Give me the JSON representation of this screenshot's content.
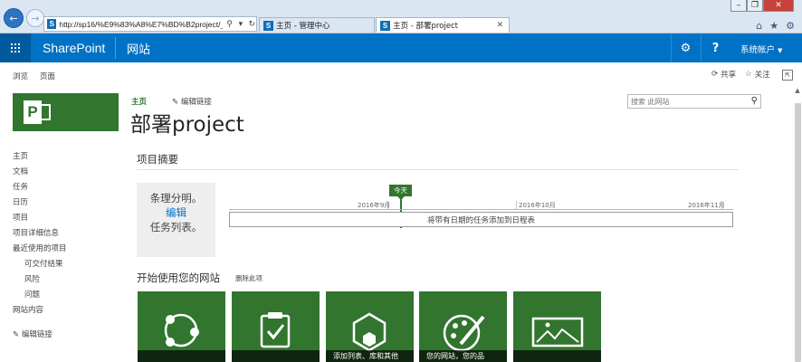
{
  "browser": {
    "address_url": "http://sp16/%E9%83%A8%E7%BD%B2project/_la",
    "tabs": [
      {
        "label": "主页 - 管理中心"
      },
      {
        "label": "主页 - 部署project"
      }
    ]
  },
  "suite_bar": {
    "brand": "SharePoint",
    "sites_label": "网站",
    "user_label": "系统帐户",
    "accent": "#0072c6"
  },
  "ribbon": {
    "tabs": [
      "浏览",
      "页面"
    ],
    "share_label": "共享",
    "follow_label": "关注"
  },
  "site": {
    "top_nav_home": "主页",
    "edit_links": "编辑链接",
    "title": "部署project",
    "search_placeholder": "搜索 此网站",
    "brand_green": "#31752f"
  },
  "quick_launch": {
    "items": [
      {
        "label": "主页",
        "sub": false
      },
      {
        "label": "文档",
        "sub": false
      },
      {
        "label": "任务",
        "sub": false
      },
      {
        "label": "日历",
        "sub": false
      },
      {
        "label": "项目",
        "sub": false
      },
      {
        "label": "项目详细信息",
        "sub": false
      },
      {
        "label": "最近使用的项目",
        "sub": false
      },
      {
        "label": "可交付结果",
        "sub": true
      },
      {
        "label": "风险",
        "sub": true
      },
      {
        "label": "问题",
        "sub": true
      },
      {
        "label": "网站内容",
        "sub": false
      }
    ],
    "edit_links": "编辑链接"
  },
  "project_summary": {
    "title": "项目摘要",
    "box_line1": "条理分明。",
    "box_edit": "编辑",
    "box_line3": "任务列表。",
    "today_label": "今天",
    "months": [
      "2016年9月",
      "2016年10月",
      "2016年11月"
    ],
    "timeline_text": "将带有日期的任务添加到日程表"
  },
  "get_started": {
    "title": "开始使用您的网站",
    "remove_label": "删除此项",
    "tiles": [
      {
        "caption": "",
        "icon": "share-circle-icon"
      },
      {
        "caption": "",
        "icon": "clipboard-check-icon"
      },
      {
        "caption": "添加列表、库和其他",
        "icon": "hexagon-app-icon"
      },
      {
        "caption": "您的网站，您的品",
        "icon": "palette-icon"
      },
      {
        "caption": "",
        "icon": "picture-icon"
      }
    ]
  }
}
